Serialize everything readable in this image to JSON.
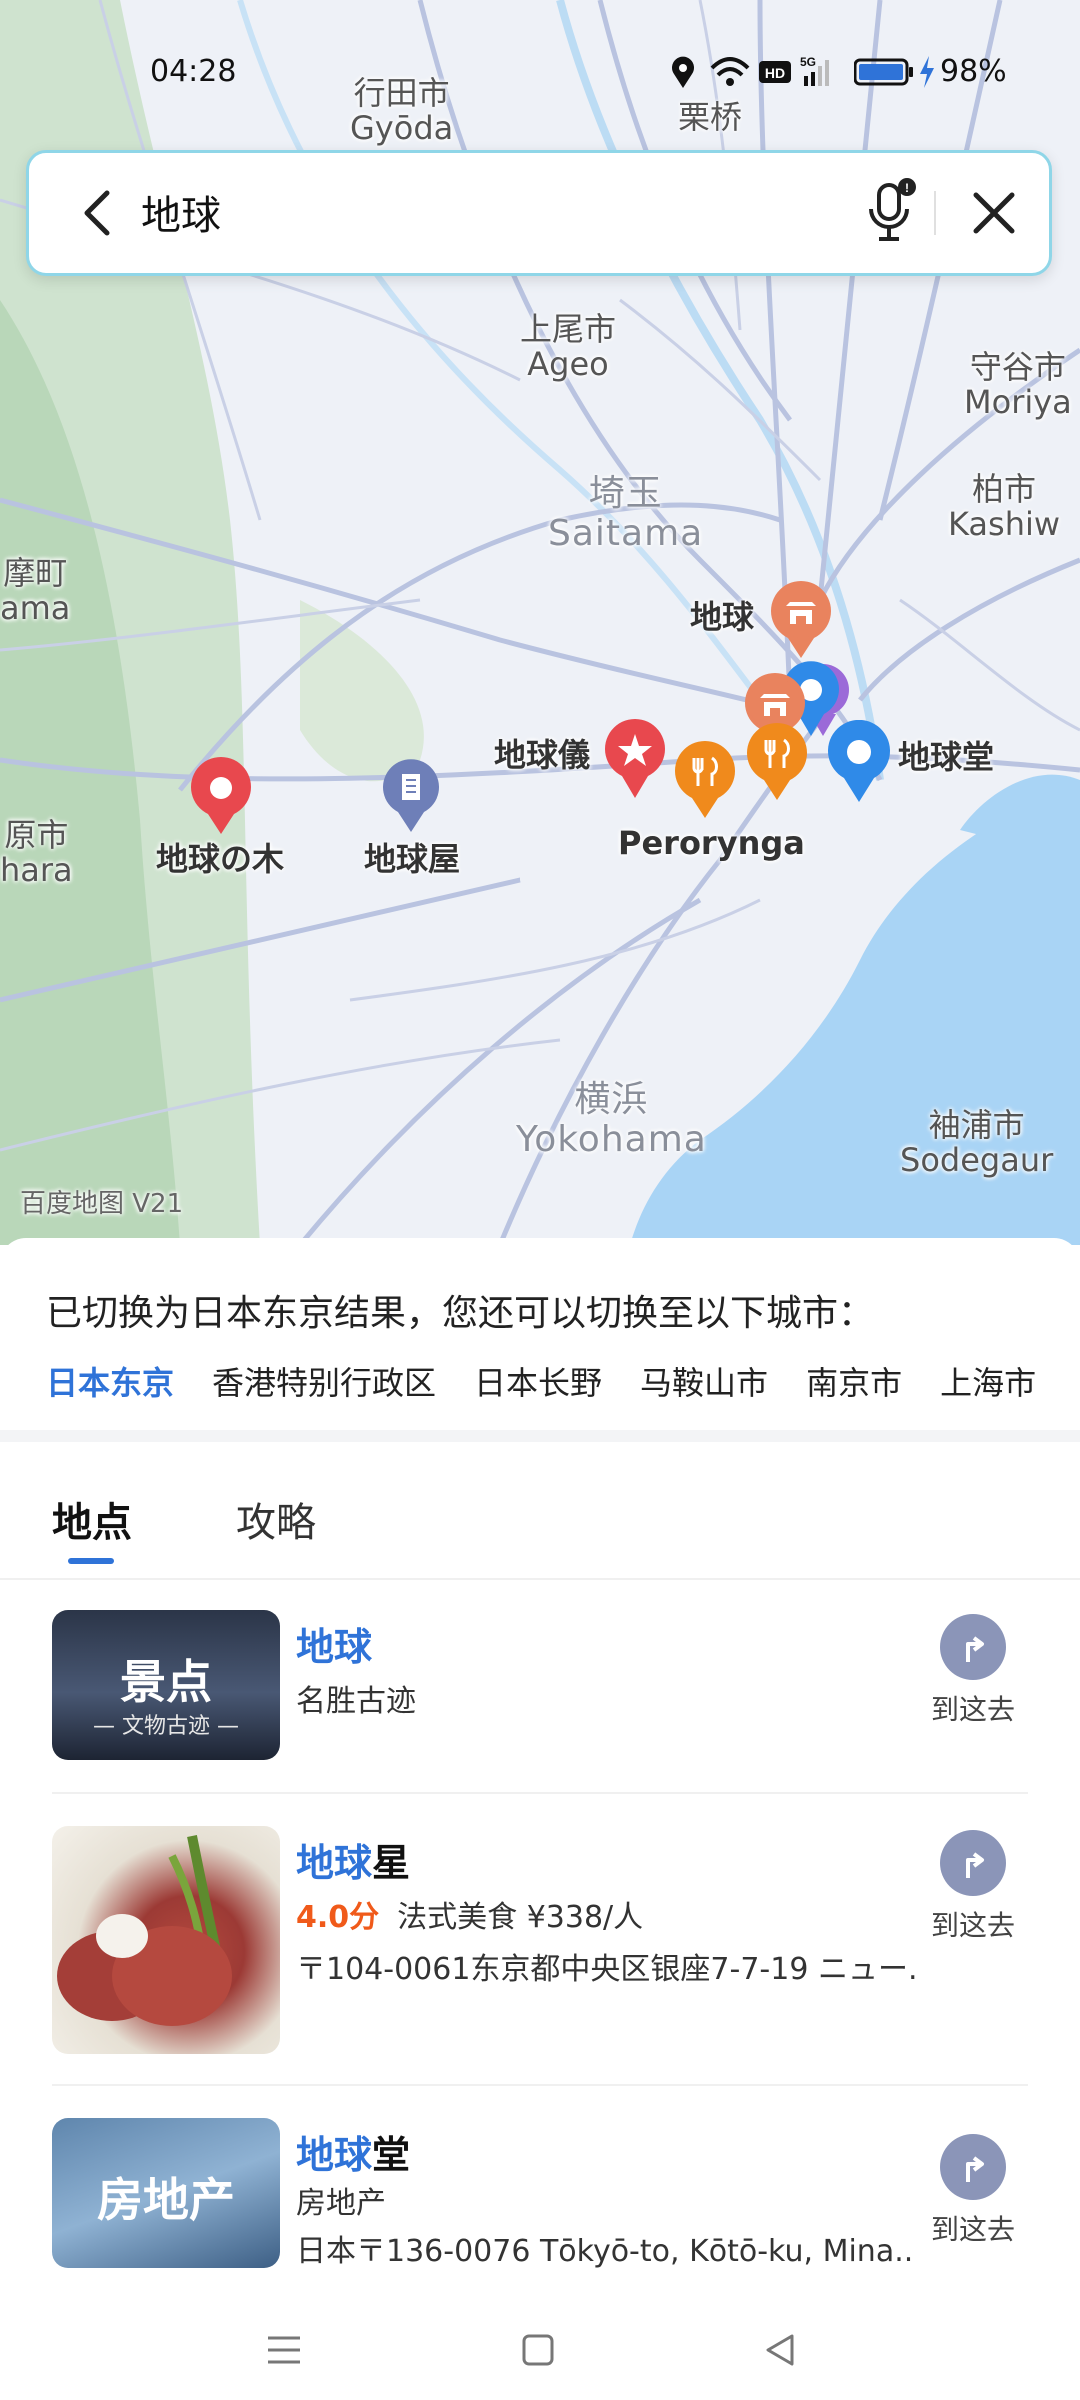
{
  "status_bar": {
    "time": "04:28",
    "battery": "98%"
  },
  "search": {
    "query": "地球"
  },
  "map": {
    "place_labels": [
      {
        "text": "行田市\nGyōda"
      },
      {
        "text": "栗桥"
      },
      {
        "text": "上尾市\nAgeo"
      },
      {
        "text": "守谷市\nMoriya"
      },
      {
        "text": "埼玉\nSaitama"
      },
      {
        "text": "柏市\nKashiw"
      },
      {
        "text": "摩町\nama"
      },
      {
        "text": "原市\nhara"
      },
      {
        "text": "横浜\nYokohama"
      },
      {
        "text": "袖浦市\nSodegaur"
      }
    ],
    "poi_labels": [
      {
        "text": "地球"
      },
      {
        "text": "地球儀"
      },
      {
        "text": "地球堂"
      },
      {
        "text": "地球の木"
      },
      {
        "text": "地球屋"
      },
      {
        "text": "Perorynga"
      }
    ],
    "watermark": "百度地图 V21"
  },
  "city_switch": {
    "notice": "已切换为日本东京结果，您还可以切换至以下城市：",
    "cities": [
      "日本东京",
      "香港特别行政区",
      "日本长野",
      "马鞍山市",
      "南京市",
      "上海市"
    ]
  },
  "tabs": [
    "地点",
    "攻略"
  ],
  "results": [
    {
      "title_highlight": "地球",
      "title_rest": "",
      "line1": "名胜古迹",
      "line2": "",
      "thumb_title": "景点",
      "thumb_sub": "— 文物古迹 —",
      "go_label": "到这去"
    },
    {
      "title_highlight": "地球",
      "title_rest": "星",
      "rating": "4.0分",
      "line1": "法式美食 ¥338/人",
      "line2": "〒104-0061东京都中央区银座7-7-19 ニュー...",
      "go_label": "到这去"
    },
    {
      "title_highlight": "地球",
      "title_rest": "堂",
      "line1": "房地产",
      "line2": "日本〒136-0076 Tōkyō-to, Kōtō-ku, Mina...",
      "thumb_title": "房地产",
      "go_label": "到这去"
    }
  ]
}
